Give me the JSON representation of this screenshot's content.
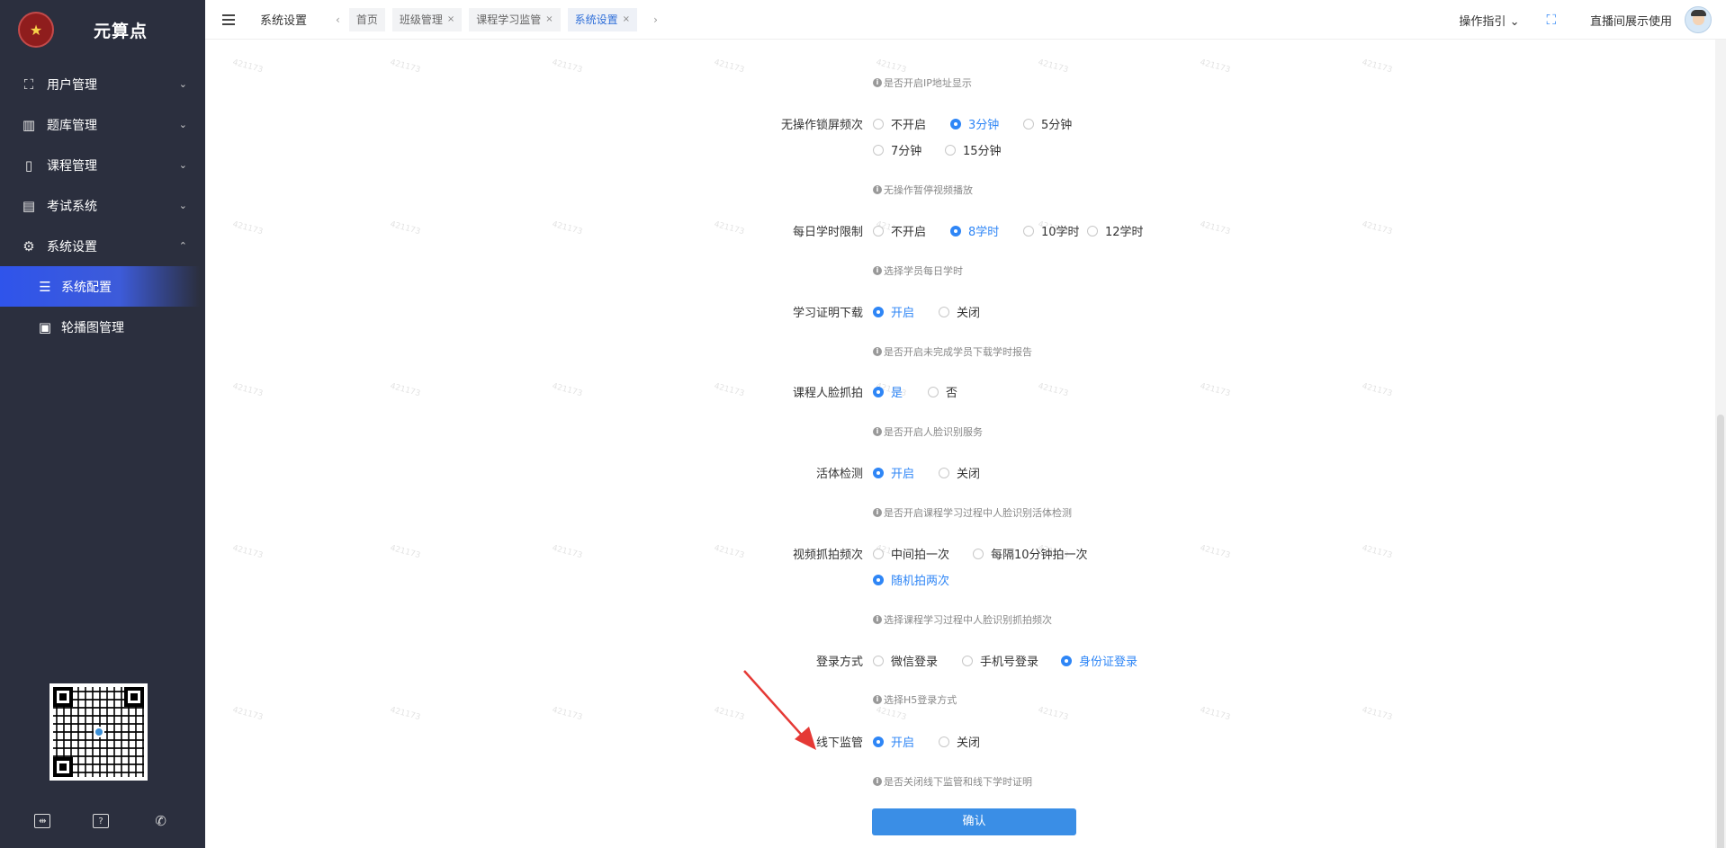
{
  "sidebar": {
    "logo_symbol": "★",
    "brand": "元算点",
    "items": [
      {
        "label": "用户管理",
        "icon": "users-icon",
        "glyph": "⛶",
        "chev": "⌄"
      },
      {
        "label": "题库管理",
        "icon": "library-icon",
        "glyph": "▥",
        "chev": "⌄"
      },
      {
        "label": "课程管理",
        "icon": "book-icon",
        "glyph": "▯",
        "chev": "⌄"
      },
      {
        "label": "考试系统",
        "icon": "exam-icon",
        "glyph": "▤",
        "chev": "⌄"
      },
      {
        "label": "系统设置",
        "icon": "gear-icon",
        "glyph": "⚙",
        "chev": "⌃"
      }
    ],
    "sub_items": [
      {
        "label": "系统配置",
        "icon": "sliders-icon",
        "glyph": "☰"
      },
      {
        "label": "轮播图管理",
        "icon": "image-icon",
        "glyph": "▣"
      }
    ],
    "bottom": [
      {
        "icon": "screen-icon",
        "glyph": "⇹"
      },
      {
        "icon": "help-icon",
        "glyph": "?"
      },
      {
        "icon": "phone-icon",
        "glyph": "✆"
      }
    ]
  },
  "header": {
    "title": "系统设置",
    "left_arrow": "‹",
    "right_arrow": "›",
    "tabs": [
      {
        "label": "首页",
        "closable": false
      },
      {
        "label": "班级管理",
        "closable": true
      },
      {
        "label": "课程学习监管",
        "closable": true
      },
      {
        "label": "系统设置",
        "closable": true,
        "active": true
      }
    ],
    "close_glyph": "×",
    "guide": "操作指引",
    "guide_chev": "⌄",
    "fullscreen_glyph": "⛶",
    "user": "直播间展示使用"
  },
  "watermark": "421173",
  "form": {
    "top_hint": "是否开启IP地址显示",
    "info_glyph": "i",
    "rows": [
      {
        "label": "无操作锁屏频次",
        "options": [
          "不开启",
          "3分钟",
          "5分钟",
          "7分钟",
          "15分钟"
        ],
        "selected": "3分钟",
        "hint": "无操作暂停视频播放"
      },
      {
        "label": "每日学时限制",
        "options": [
          "不开启",
          "8学时",
          "10学时",
          "12学时"
        ],
        "selected": "8学时",
        "hint": "选择学员每日学时"
      },
      {
        "label": "学习证明下载",
        "options": [
          "开启",
          "关闭"
        ],
        "selected": "开启",
        "hint": "是否开启未完成学员下载学时报告"
      },
      {
        "label": "课程人脸抓拍",
        "options": [
          "是",
          "否"
        ],
        "selected": "是",
        "hint": "是否开启人脸识别服务"
      },
      {
        "label": "活体检测",
        "options": [
          "开启",
          "关闭"
        ],
        "selected": "开启",
        "hint": "是否开启课程学习过程中人脸识别活体检测"
      },
      {
        "label": "视频抓拍频次",
        "options": [
          "中间拍一次",
          "每隔10分钟拍一次",
          "随机拍两次"
        ],
        "selected": "随机拍两次",
        "hint": "选择课程学习过程中人脸识别抓拍频次"
      },
      {
        "label": "登录方式",
        "options": [
          "微信登录",
          "手机号登录",
          "身份证登录"
        ],
        "selected": "身份证登录",
        "hint": "选择H5登录方式"
      },
      {
        "label": "线下监管",
        "options": [
          "开启",
          "关闭"
        ],
        "selected": "开启",
        "hint": "是否关闭线下监管和线下学时证明"
      }
    ],
    "confirm": "确认"
  },
  "colors": {
    "accent": "#2f86f6",
    "sidebar": "#2b2f3e",
    "arrow": "#e53935"
  }
}
